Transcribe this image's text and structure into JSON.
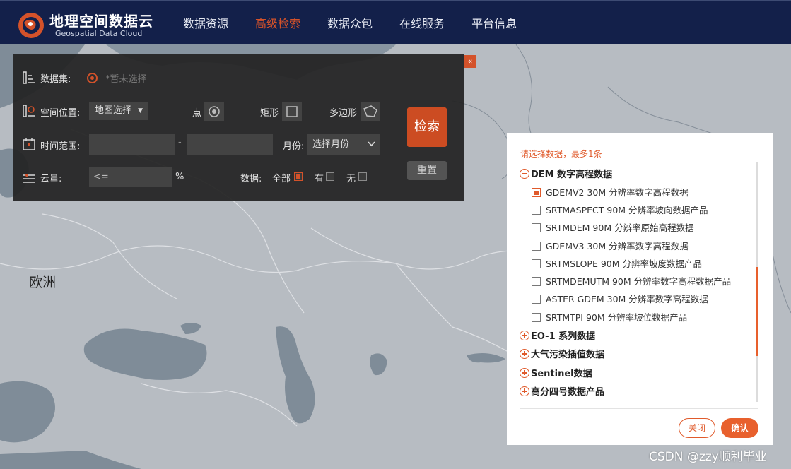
{
  "brand": {
    "name_cn": "地理空间数据云",
    "name_en": "Geospatial Data Cloud"
  },
  "nav": {
    "items": [
      "数据资源",
      "高级检索",
      "数据众包",
      "在线服务",
      "平台信息"
    ],
    "active": "高级检索"
  },
  "map": {
    "label": "欧洲"
  },
  "search_panel": {
    "collapse_label": "«",
    "dataset": {
      "label": "数据集:",
      "hint": "*暂未选择"
    },
    "location": {
      "label": "空间位置:",
      "select_value": "地图选择",
      "point_label": "点",
      "rect_label": "矩形",
      "polygon_label": "多边形"
    },
    "time": {
      "label": "时间范围:",
      "start_value": "",
      "separator": "-",
      "end_value": "",
      "month_label": "月份:",
      "month_select": "选择月份"
    },
    "cloud": {
      "label": "云量:",
      "operator": "<=",
      "unit": "%",
      "data_label": "数据:",
      "options": [
        {
          "label": "全部",
          "checked": true
        },
        {
          "label": "有",
          "checked": false
        },
        {
          "label": "无",
          "checked": false
        }
      ]
    },
    "search_button": "检索",
    "reset_button": "重置"
  },
  "dataset_dialog": {
    "hint": "请选择数据，最多1条",
    "expanded_category": {
      "label": "DEM 数字高程数据",
      "items": [
        {
          "label": "GDEMV2 30M 分辨率数字高程数据",
          "checked": true
        },
        {
          "label": "SRTMASPECT 90M 分辨率坡向数据产品",
          "checked": false
        },
        {
          "label": "SRTMDEM 90M 分辨率原始高程数据",
          "checked": false
        },
        {
          "label": "GDEMV3 30M 分辨率数字高程数据",
          "checked": false
        },
        {
          "label": "SRTMSLOPE 90M 分辨率坡度数据产品",
          "checked": false
        },
        {
          "label": "SRTMDEMUTM 90M 分辨率数字高程数据产品",
          "checked": false
        },
        {
          "label": "ASTER GDEM 30M 分辨率数字高程数据",
          "checked": false
        },
        {
          "label": "SRTMTPI 90M 分辨率坡位数据产品",
          "checked": false
        }
      ]
    },
    "collapsed_categories": [
      "EO-1 系列数据",
      "大气污染插值数据",
      "Sentinel数据",
      "高分四号数据产品"
    ],
    "close_button": "关闭",
    "confirm_button": "确认"
  },
  "watermark": "CSDN @zzy顺利毕业",
  "colors": {
    "accent": "#e05a2b",
    "header_bg": "#13204a",
    "panel_bg": "#222222"
  }
}
